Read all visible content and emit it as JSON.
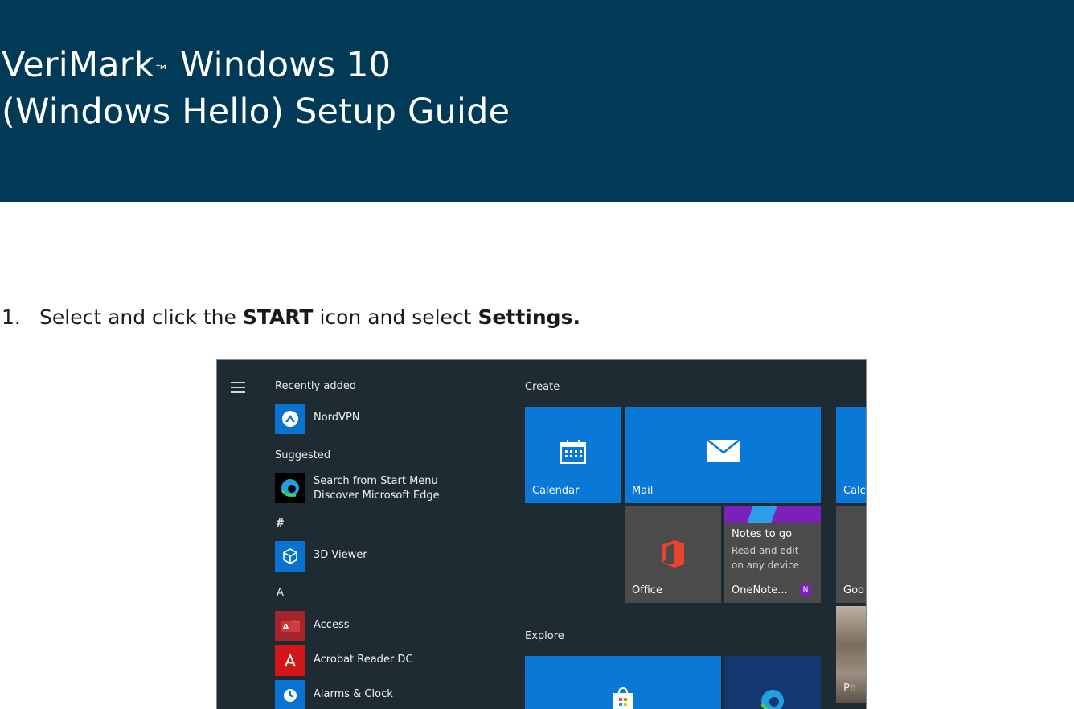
{
  "doc": {
    "title_line1": "VeriMark",
    "title_tm": "™",
    "title_line1_rest": " Windows 10",
    "title_line2": "(Windows Hello) Setup Guide",
    "step_number": "1.",
    "step_pre": "Select and click the ",
    "step_bold1": "START",
    "step_mid": " icon and select ",
    "step_bold2": "Settings."
  },
  "start_menu": {
    "recently_added": "Recently added",
    "nordvpn": "NordVPN",
    "suggested": "Suggested",
    "edge_line1": "Search from Start Menu",
    "edge_line2": "Discover Microsoft Edge",
    "hash": "#",
    "viewer3d": "3D Viewer",
    "letter_a": "A",
    "access": "Access",
    "acrobat": "Acrobat Reader DC",
    "alarms": "Alarms & Clock",
    "create": "Create",
    "calendar": "Calendar",
    "mail": "Mail",
    "calc": "Calc",
    "office": "Office",
    "onenote_title": "Notes to go",
    "onenote_line1": "Read and edit",
    "onenote_line2": "on any device",
    "onenote_label": "OneNote...",
    "goo": "Goo",
    "explore": "Explore",
    "phot": "Ph"
  }
}
